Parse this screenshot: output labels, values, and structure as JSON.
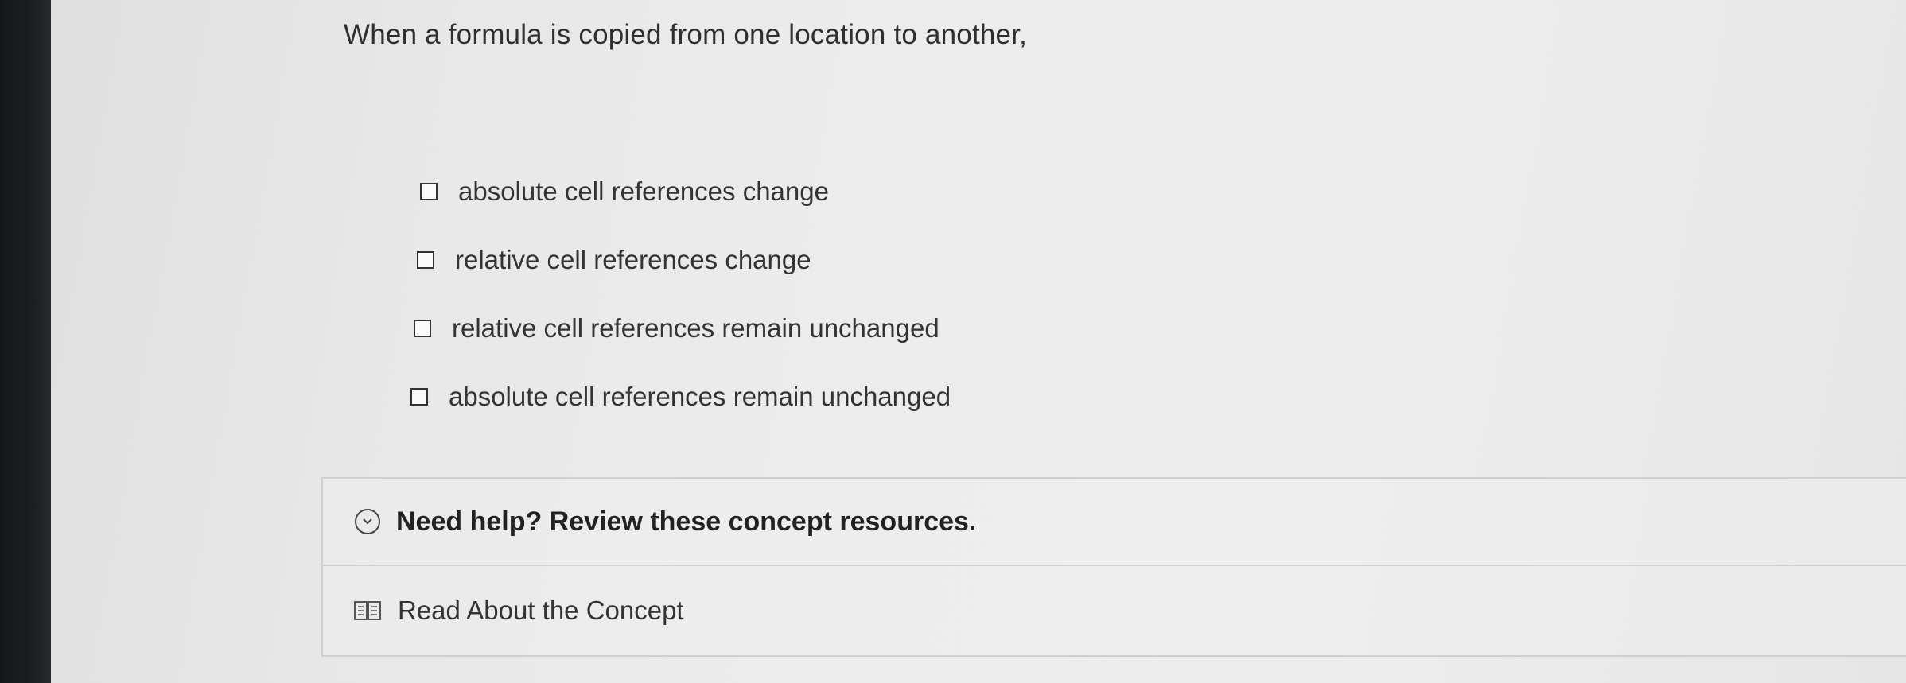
{
  "question": {
    "text": "When a formula is copied from one location to another,"
  },
  "options": [
    {
      "label": "absolute cell references change",
      "checked": false
    },
    {
      "label": "relative cell references change",
      "checked": false
    },
    {
      "label": "relative cell references remain unchanged",
      "checked": false
    },
    {
      "label": "absolute cell references remain unchanged",
      "checked": false
    }
  ],
  "help": {
    "title": "Need help? Review these concept resources.",
    "icon": "chevron-down-circle-icon",
    "resources": [
      {
        "label": "Read About the Concept",
        "icon": "book-icon"
      }
    ]
  }
}
